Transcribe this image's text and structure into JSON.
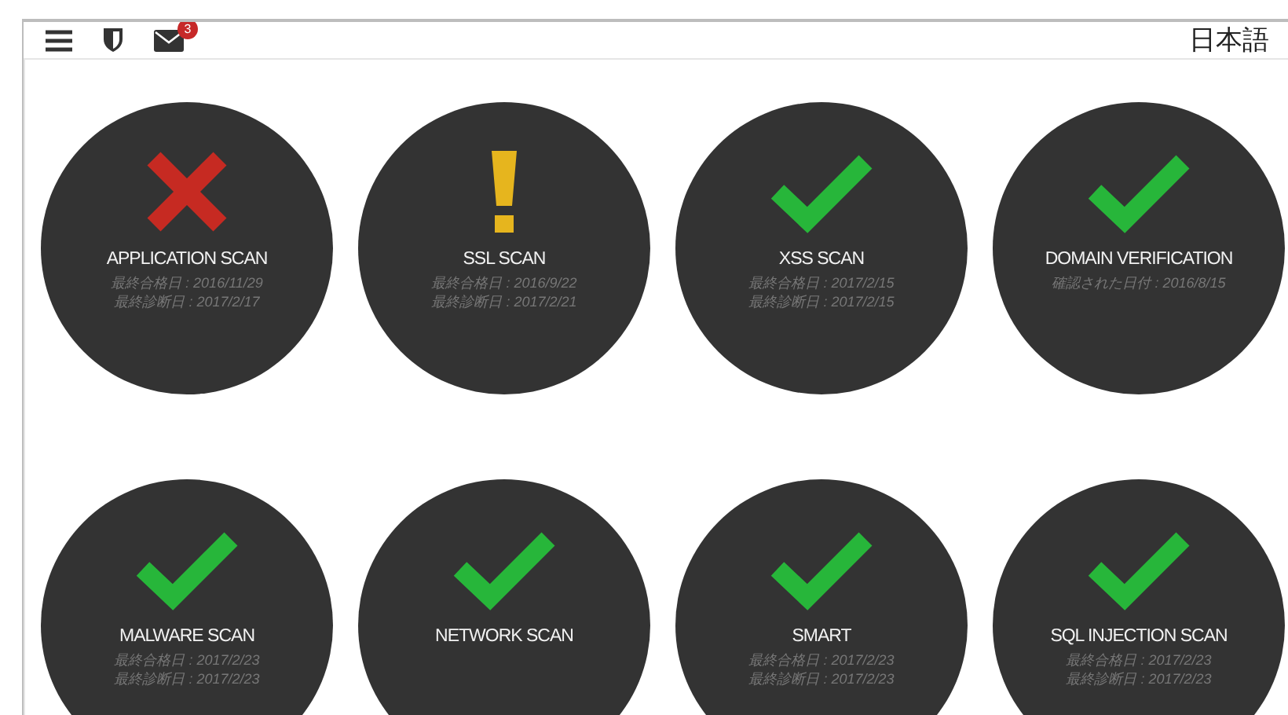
{
  "header": {
    "mail_count": "3",
    "language": "日本語"
  },
  "scans": [
    {
      "title": "APPLICATION SCAN",
      "kind": "fail",
      "lines": [
        "最終合格日 : 2016/11/29",
        "最終診断日 : 2017/2/17"
      ]
    },
    {
      "title": "SSL SCAN",
      "kind": "warning",
      "lines": [
        "最終合格日 : 2016/9/22",
        "最終診断日 : 2017/2/21"
      ]
    },
    {
      "title": "XSS SCAN",
      "kind": "pass",
      "lines": [
        "最終合格日 : 2017/2/15",
        "最終診断日 : 2017/2/15"
      ]
    },
    {
      "title": "DOMAIN VERIFICATION",
      "kind": "pass",
      "lines": [
        "確認された日付 : 2016/8/15"
      ]
    },
    {
      "title": "MALWARE SCAN",
      "kind": "pass",
      "lines": [
        "最終合格日 : 2017/2/23",
        "最終診断日 : 2017/2/23"
      ]
    },
    {
      "title": "NETWORK SCAN",
      "kind": "pass"
    },
    {
      "title": "SMART",
      "kind": "pass",
      "lines": [
        "最終合格日 : 2017/2/23",
        "最終診断日 : 2017/2/23"
      ]
    },
    {
      "title": "SQL INJECTION SCAN",
      "kind": "pass",
      "lines": [
        "最終合格日 : 2017/2/23",
        "最終診断日 : 2017/2/23"
      ]
    }
  ]
}
